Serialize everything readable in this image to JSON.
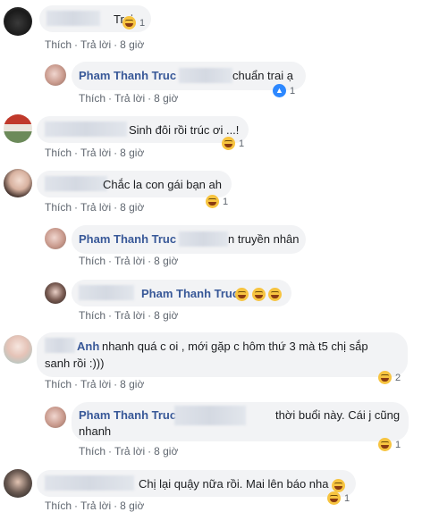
{
  "actions": {
    "like": "Thích",
    "reply": "Trả lời",
    "dot": "·",
    "time": "8 giờ"
  },
  "comments": [
    {
      "text": "Trai",
      "reaction_count": "1"
    },
    {
      "name": "Pham Thanh Truc",
      "text": "chuẩn trai ạ",
      "reaction_count": "1"
    },
    {
      "text": "Sinh đôi rồi trúc ơi ...!",
      "reaction_count": "1"
    },
    {
      "text": "Chắc la con gái bạn ah",
      "reaction_count": "1"
    },
    {
      "name": "Pham Thanh Truc",
      "text": "n truyền nhân"
    },
    {
      "name": "Pham Thanh Truc"
    },
    {
      "name_partial": "Anh",
      "text_line1": "nhanh quá c oi , mới gặp c hôm thứ 3 mà t5 chị sắp",
      "text_line2": "sanh rồi :)))",
      "reaction_count": "2"
    },
    {
      "name": "Pham Thanh Truc",
      "text_line1": "thời buổi này. Cái j cũng",
      "text_line2": "nhanh",
      "reaction_count": "1"
    },
    {
      "text": "Chị lại quậy nữa rồi. Mai lên báo nha",
      "reaction_count": "1"
    }
  ],
  "colors": {
    "name": "#385898",
    "bubble": "#f2f3f5",
    "meta": "#606770",
    "haha": "#f7c440",
    "like": "#2d88ff"
  },
  "icons": {
    "haha": "laughing-emoji-icon",
    "like": "thumbs-up-icon"
  }
}
